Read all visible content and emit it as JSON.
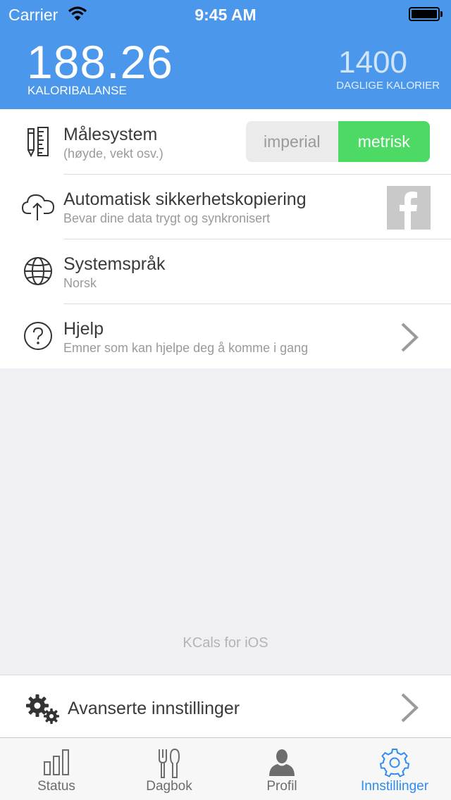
{
  "status_bar": {
    "carrier": "Carrier",
    "time": "9:45 AM"
  },
  "header": {
    "balance_value": "188.26",
    "balance_label": "KALORIBALANSE",
    "daily_value": "1400",
    "daily_label": "DAGLIGE KALORIER"
  },
  "settings": {
    "units": {
      "title": "Målesystem",
      "subtitle": "(høyde, vekt osv.)",
      "option_imperial": "imperial",
      "option_metric": "metrisk",
      "selected": "metrisk"
    },
    "backup": {
      "title": "Automatisk sikkerhetskopiering",
      "subtitle": "Bevar dine data trygt og synkronisert"
    },
    "language": {
      "title": "Systemspråk",
      "subtitle": "Norsk"
    },
    "help": {
      "title": "Hjelp",
      "subtitle": "Emner som kan hjelpe deg å komme i gang"
    }
  },
  "footer_text": "KCals for iOS",
  "advanced": {
    "label": "Avanserte innstillinger"
  },
  "tabs": [
    {
      "label": "Status",
      "icon": "bar-chart-icon"
    },
    {
      "label": "Dagbok",
      "icon": "fork-knife-icon"
    },
    {
      "label": "Profil",
      "icon": "person-icon"
    },
    {
      "label": "Innstillinger",
      "icon": "gear-icon",
      "active": true
    }
  ],
  "colors": {
    "header": "#4a97ec",
    "accent_green": "#4cd964",
    "active_tab": "#2f8cf0"
  }
}
